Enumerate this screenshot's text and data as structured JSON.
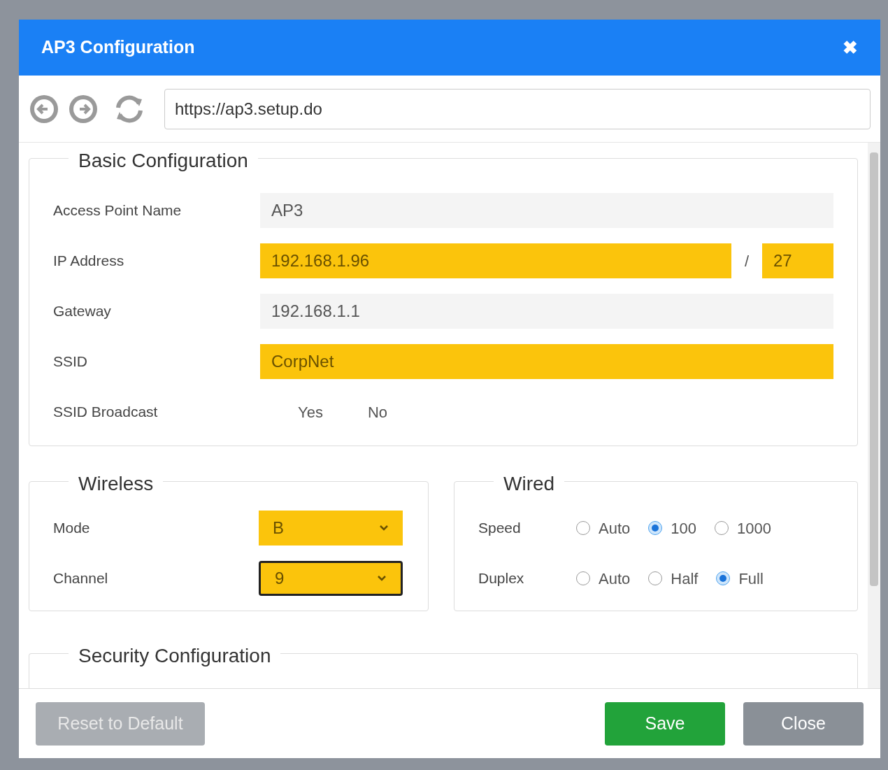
{
  "window": {
    "title": "AP3 Configuration",
    "close": "✖"
  },
  "address_bar": {
    "url": "https://ap3.setup.do"
  },
  "basic": {
    "title": "Basic Configuration",
    "access_point_name": {
      "label": "Access Point Name",
      "value": "AP3",
      "highlighted": false
    },
    "ip_address": {
      "label": "IP Address",
      "value": "192.168.1.96",
      "separator": "/",
      "prefix": "27",
      "highlighted": true
    },
    "gateway": {
      "label": "Gateway",
      "value": "192.168.1.1",
      "highlighted": false
    },
    "ssid": {
      "label": "SSID",
      "value": "CorpNet",
      "highlighted": true
    },
    "ssid_broadcast": {
      "label": "SSID Broadcast",
      "options": [
        "Yes",
        "No"
      ]
    }
  },
  "wireless": {
    "title": "Wireless",
    "fields": [
      {
        "label": "Mode",
        "value": "B",
        "focused": false
      },
      {
        "label": "Channel",
        "value": "9",
        "focused": true
      }
    ]
  },
  "wired": {
    "title": "Wired",
    "groups": [
      {
        "label": "Speed",
        "options": [
          {
            "label": "Auto",
            "selected": false
          },
          {
            "label": "100",
            "selected": true
          },
          {
            "label": "1000",
            "selected": false
          }
        ]
      },
      {
        "label": "Duplex",
        "options": [
          {
            "label": "Auto",
            "selected": false
          },
          {
            "label": "Half",
            "selected": false
          },
          {
            "label": "Full",
            "selected": true
          }
        ]
      }
    ]
  },
  "security": {
    "title": "Security Configuration"
  },
  "buttons": [
    {
      "label": "Reset to Default",
      "kind": "reset"
    },
    {
      "label": "Save",
      "kind": "save"
    },
    {
      "label": "Close",
      "kind": "close"
    }
  ]
}
